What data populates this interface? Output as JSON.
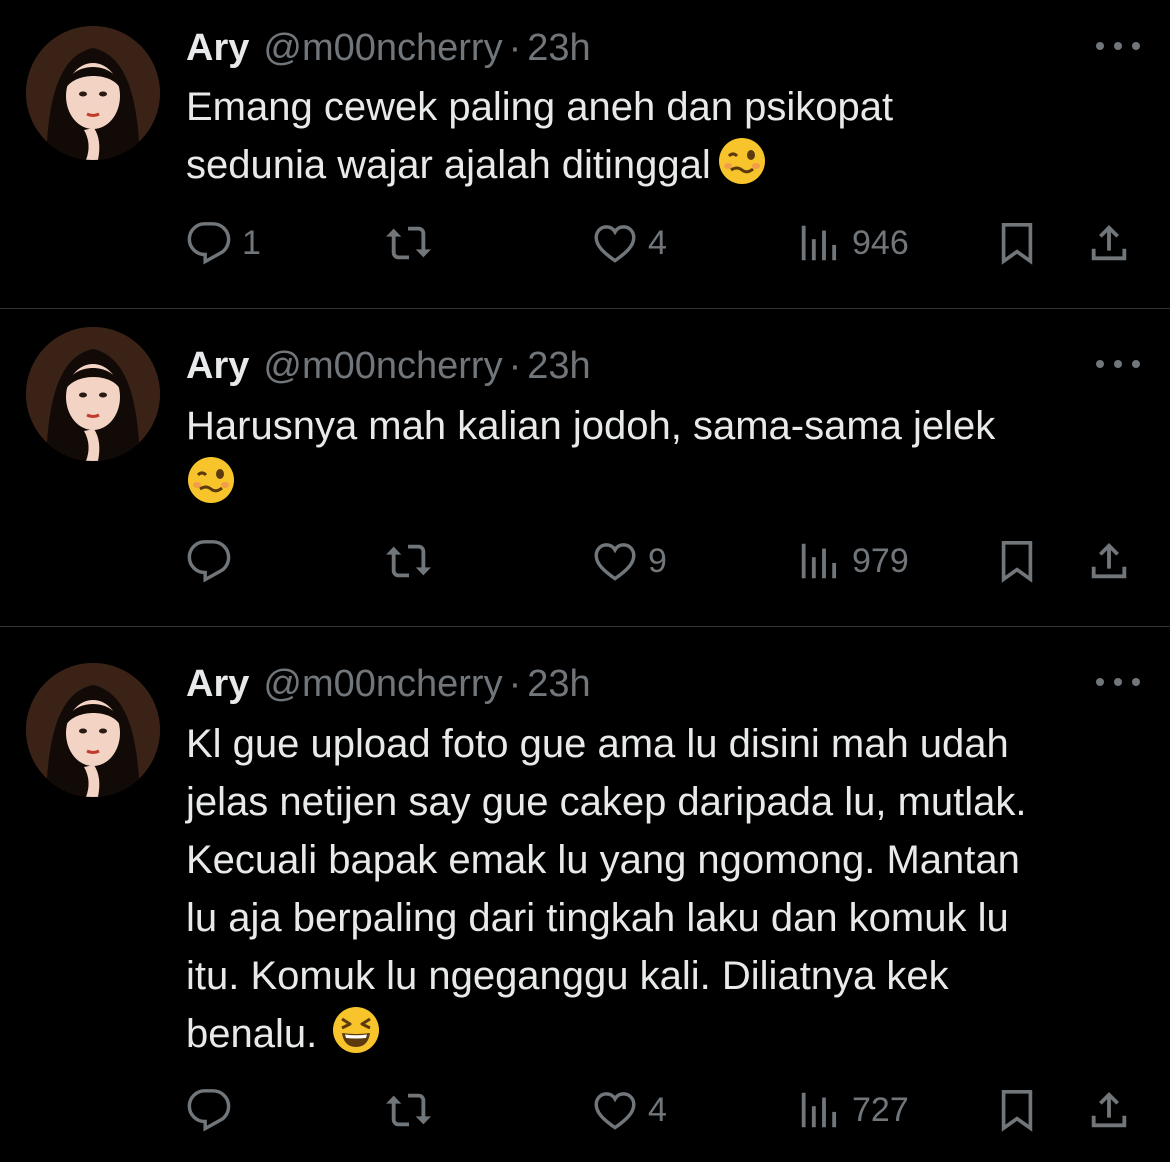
{
  "tweets": [
    {
      "author": {
        "name": "Ary",
        "handle": "@m00ncherry"
      },
      "separator": "·",
      "time": "23h",
      "text": "Emang cewek paling aneh dan psikopat\nsedunia wajar ajalah ditinggal",
      "emoji": "woozy-face",
      "stats": {
        "replies": "1",
        "retweets": "",
        "likes": "4",
        "views": "946"
      }
    },
    {
      "author": {
        "name": "Ary",
        "handle": "@m00ncherry"
      },
      "separator": "·",
      "time": "23h",
      "text": "Harusnya mah kalian jodoh, sama-sama jelek\n",
      "emoji": "woozy-face",
      "stats": {
        "replies": "",
        "retweets": "",
        "likes": "9",
        "views": "979"
      }
    },
    {
      "author": {
        "name": "Ary",
        "handle": "@m00ncherry"
      },
      "separator": "·",
      "time": "23h",
      "text": "Kl gue upload foto gue ama lu disini mah udah\njelas netijen say gue cakep daripada lu, mutlak.\nKecuali bapak emak lu yang ngomong. Mantan\nlu aja berpaling dari tingkah laku dan komuk lu\nitu. Komuk lu ngeganggu kali. Diliatnya kek\nbenalu.",
      "emoji": "grinning-squinting-face",
      "stats": {
        "replies": "",
        "retweets": "",
        "likes": "4",
        "views": "727"
      }
    }
  ],
  "colors": {
    "background": "#000000",
    "text": "#e7e9ea",
    "muted": "#71767b",
    "divider": "#2f3336",
    "emoji_yellow": "#f7c52b"
  }
}
